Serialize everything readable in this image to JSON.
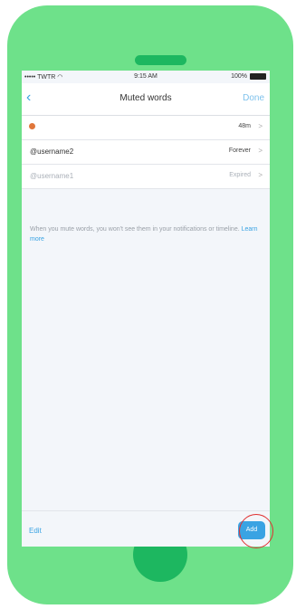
{
  "status_bar": {
    "carrier": "••••• TWTR",
    "time": "9:15 AM",
    "battery": "100%"
  },
  "nav": {
    "back_icon": "chevron-left-icon",
    "title": "Muted words",
    "done_label": "Done"
  },
  "muted_words": [
    {
      "word": "",
      "duration": "48m"
    },
    {
      "word": "@username2",
      "duration": "Forever"
    },
    {
      "word": "@username1",
      "duration": "Expired"
    }
  ],
  "info": {
    "text": "When you mute words, you won't see them in your notifications or timeline.",
    "link": "Learn more"
  },
  "footer": {
    "edit_label": "Edit",
    "add_label": "Add"
  },
  "colors": {
    "phone": "#6ee18a",
    "phone_accent": "#1db760",
    "accent": "#3aa3e3",
    "highlight": "#e03030"
  }
}
